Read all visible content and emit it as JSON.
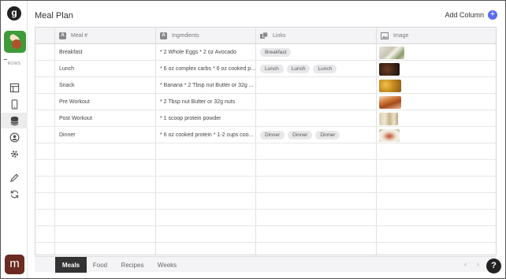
{
  "app": {
    "logo_letter": "g",
    "rail_label": "ROWS",
    "avatar_letter": "m"
  },
  "header": {
    "title": "Meal Plan",
    "add_column_label": "Add Column",
    "add_icon": "+"
  },
  "columns": [
    {
      "label": "Meal #",
      "icon": "text-type-icon"
    },
    {
      "label": "Ingredients",
      "icon": "text-type-icon"
    },
    {
      "label": "Links",
      "icon": "link-type-icon"
    },
    {
      "label": "Image",
      "icon": "image-type-icon"
    }
  ],
  "rows": [
    {
      "meal": "Breakfast",
      "ingredients": "* 2 Whole Eggs * 2 oz Avocado",
      "links": [
        "Breakfast"
      ],
      "image": "eggs-avocado-photo"
    },
    {
      "meal": "Lunch",
      "ingredients": "* 6 oz complex carbs * 6 oz cooked p...",
      "links": [
        "Lunch",
        "Lunch",
        "Lunch"
      ],
      "image": "lunch-plate-photo"
    },
    {
      "meal": "Snack",
      "ingredients": "* Banana * 2 Tbsp nut Butter or 32g ...",
      "links": [],
      "image": "snack-photo"
    },
    {
      "meal": "Pre Workout",
      "ingredients": "* 2 Tbsp nut Butter or 32g nuts",
      "links": [],
      "image": "nut-butter-photo"
    },
    {
      "meal": "Post Workout",
      "ingredients": "* 1 scoop protein powder",
      "links": [],
      "image": "protein-shake-photo"
    },
    {
      "meal": "Dinner",
      "ingredients": "* 6 oz cooked protein * 1-2 cups coo...",
      "links": [
        "Dinner",
        "Dinner",
        "Dinner"
      ],
      "image": "dinner-plate-photo"
    }
  ],
  "tabs": [
    {
      "label": "Meals",
      "active": true
    },
    {
      "label": "Food",
      "active": false
    },
    {
      "label": "Recipes",
      "active": false
    },
    {
      "label": "Weeks",
      "active": false
    }
  ],
  "pager": {
    "prev": "‹",
    "next": "›"
  },
  "help_label": "?",
  "colors": {
    "accent": "#5b6af2",
    "app_icon_bg": "#3f9b3a",
    "avatar_bg": "#6a2b22",
    "header_bg": "#f4f4f6",
    "chip_bg": "#e8e8ea"
  }
}
